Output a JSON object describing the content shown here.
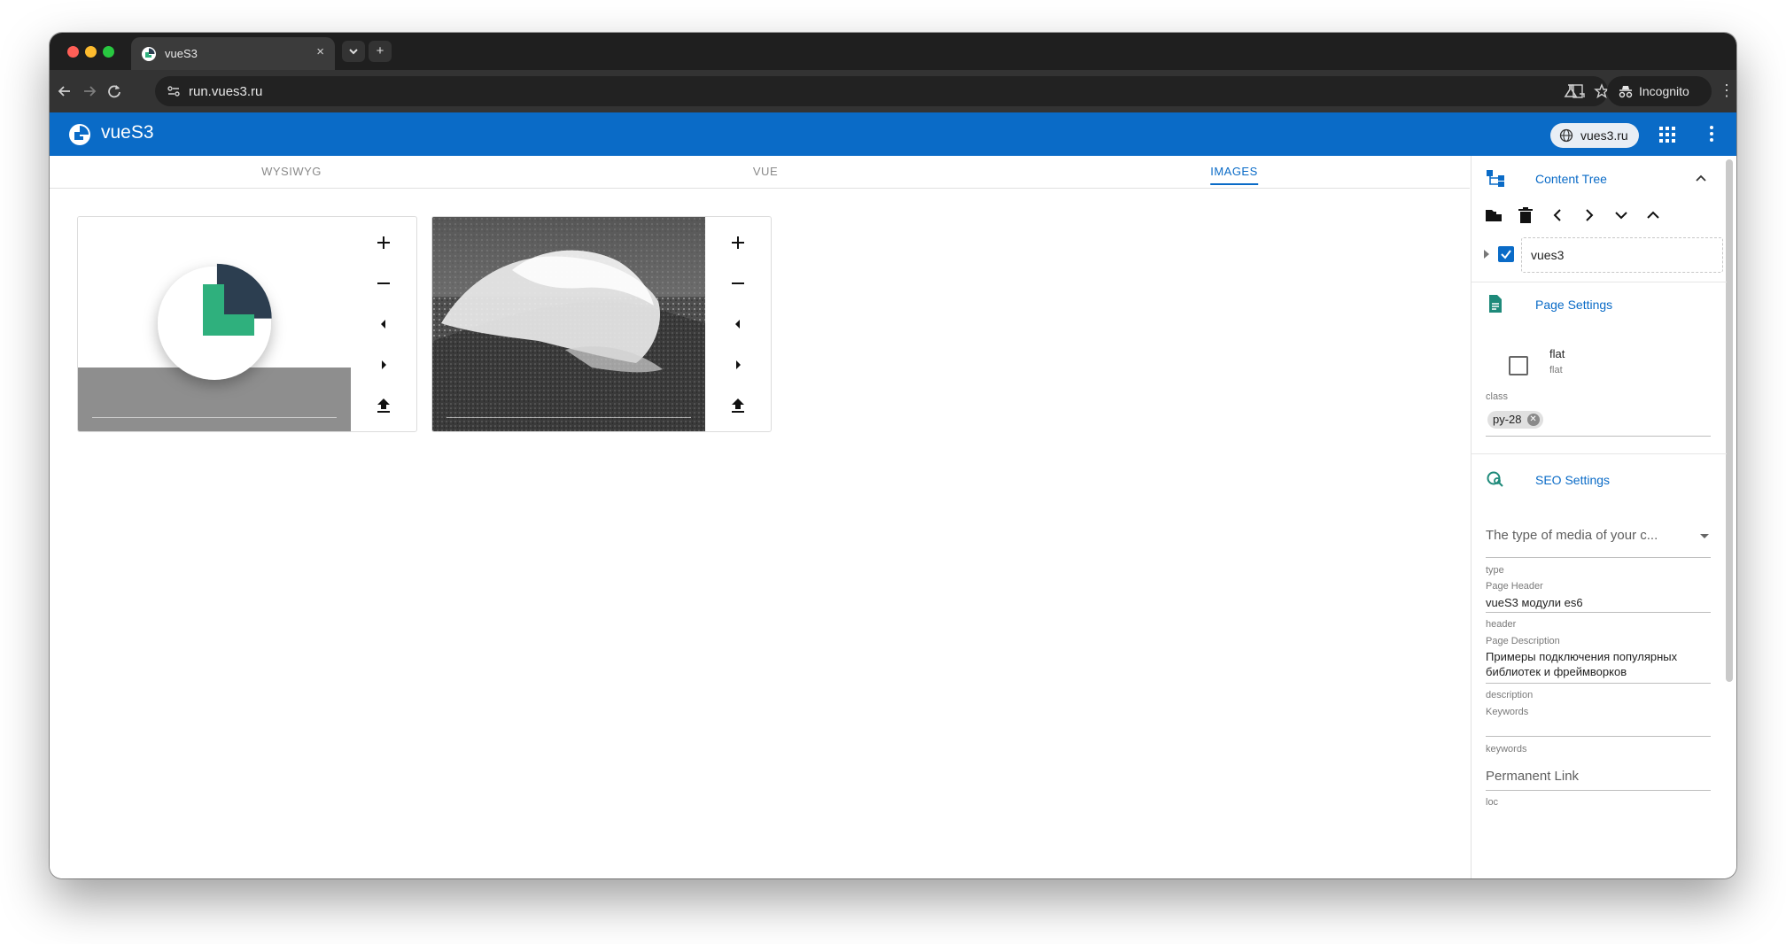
{
  "browser": {
    "tab_title": "vueS3",
    "url": "run.vues3.ru",
    "incognito_label": "Incognito",
    "new_tab_symbol": "+",
    "close_symbol": "×",
    "more_symbol": "⋮"
  },
  "appbar": {
    "title": "vueS3",
    "site_chip_label": "vues3.ru",
    "color": "#0a6bc7"
  },
  "tabs": [
    {
      "label": "WYSIWYG",
      "active": false
    },
    {
      "label": "VUE",
      "active": false
    },
    {
      "label": "IMAGES",
      "active": true
    }
  ],
  "images": [
    {
      "name": "logo-image",
      "controls": [
        "plus-icon",
        "minus-icon",
        "prev-icon",
        "next-icon",
        "upload-icon"
      ]
    },
    {
      "name": "wave-photo",
      "controls": [
        "plus-icon",
        "minus-icon",
        "prev-icon",
        "next-icon",
        "upload-icon"
      ]
    }
  ],
  "panel": {
    "content_tree": {
      "title": "Content Tree",
      "toolbar_icons": [
        "new-folder-icon",
        "delete-icon",
        "chevron-left-icon",
        "chevron-right-icon",
        "chevron-down-icon",
        "chevron-up-icon"
      ],
      "node_label": "vues3"
    },
    "page_settings": {
      "title": "Page Settings",
      "flat_label": "flat",
      "flat_caption": "flat",
      "class_label": "class",
      "class_chip": "py-28"
    },
    "seo_settings": {
      "title": "SEO Settings",
      "type_select_placeholder": "The type of media of your c...",
      "type_label": "type",
      "page_header_label": "Page Header",
      "page_header_value": "vueS3 модули es6",
      "header_label": "header",
      "page_description_label": "Page Description",
      "page_description_value_line1": "Примеры подключения популярных",
      "page_description_value_line2": "библиотек и фреймворков",
      "description_label": "description",
      "keywords_field_label": "Keywords",
      "keywords_label": "keywords",
      "permanent_link_placeholder": "Permanent Link",
      "loc_label": "loc"
    }
  },
  "colors": {
    "accent": "#0a6bc7",
    "logo_green": "#2fb07d",
    "logo_dark": "#2c3e50",
    "teal_icon": "#1e8a7a"
  }
}
